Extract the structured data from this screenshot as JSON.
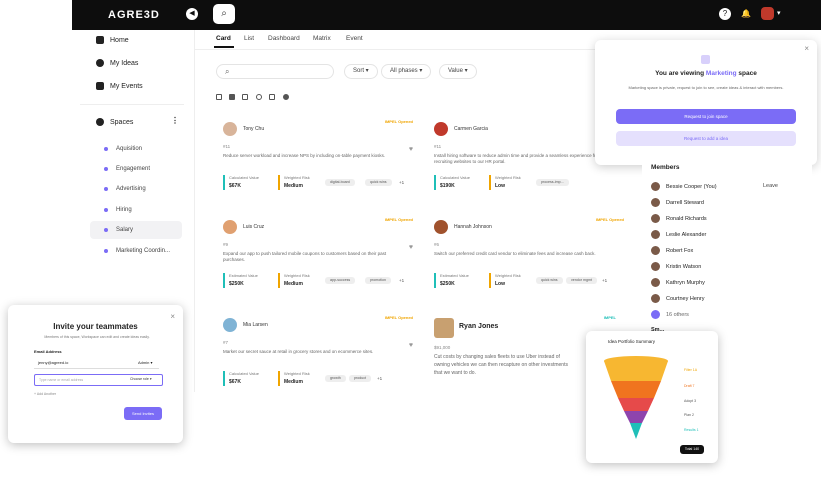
{
  "app": {
    "logo": "AGRE3D"
  },
  "colors": {
    "accent": "#7b6cf6",
    "teal": "#1fbfb8",
    "orange": "#f0a500"
  },
  "topbar": {
    "help_icon": "?",
    "notif_icon": "🔔"
  },
  "sidebar": {
    "items": [
      {
        "label": "Home",
        "icon": "home-icon"
      },
      {
        "label": "My Ideas",
        "icon": "lightbulb-icon"
      },
      {
        "label": "My Events",
        "icon": "calendar-icon"
      }
    ],
    "spaces_label": "Spaces",
    "spaces": [
      "Aquisition",
      "Engagement",
      "Advertising",
      "Hiring",
      "Salary",
      "Marketing Coordin..."
    ]
  },
  "tabs": [
    "Card",
    "List",
    "Dashboard",
    "Matrix",
    "Event"
  ],
  "filters": {
    "sort": "Sort",
    "phases": "All phases",
    "value": "Value"
  },
  "cards": [
    {
      "name": "Tony Chu",
      "tag": "IMPEL Opened",
      "id": "#11",
      "desc": "Reduce server workload and increase NPS by including on-table payment kiosks.",
      "m1l": "Calculated Value",
      "m1v": "$67K",
      "m2l": "Weighted Risk",
      "m2v": "Medium",
      "chips": [
        "digital-board",
        "quick wins"
      ],
      "more": "+1"
    },
    {
      "name": "Carmen Garcia",
      "tag": "IMPEL Opened",
      "id": "#11",
      "desc": "Install hiring software to reduce admin time and provide a seamless experience from recruiting websites to our HR portal.",
      "m1l": "Calculated Value",
      "m1v": "$190K",
      "m2l": "Weighted Risk",
      "m2v": "Low",
      "chips": [
        "process-imp..."
      ],
      "more": ""
    },
    {
      "name": "Luis Cruz",
      "tag": "IMPEL Opened",
      "id": "#9",
      "desc": "Expand our app to push tailored mobile coupons to customers based on their past purchases.",
      "m1l": "Estimated Value",
      "m1v": "$250K",
      "m2l": "Weighted Risk",
      "m2v": "Medium",
      "chips": [
        "app-success",
        "promotion"
      ],
      "more": "+1"
    },
    {
      "name": "Hannah Johnson",
      "tag": "IMPEL Opened",
      "id": "#6",
      "desc": "Switch our preferred credit card vendor to eliminate fees and increase cash back.",
      "m1l": "Estimated Value",
      "m1v": "$250K",
      "m2l": "Weighted Risk",
      "m2v": "Low",
      "chips": [
        "quick wins",
        "vendor mgmt"
      ],
      "more": "+1"
    },
    {
      "name": "Mia Larsen",
      "tag": "IMPEL Opened",
      "id": "#7",
      "desc": "Market our secret sauce at retail in grocery stores and on ecommerce sites.",
      "m1l": "Calculated Value",
      "m1v": "$67K",
      "m2l": "Weighted Risk",
      "m2v": "Medium",
      "chips": [
        "growth",
        "product"
      ],
      "more": "+1"
    },
    {
      "name": "Ryan Jones",
      "tag": "IMPEL",
      "id": "$91,000",
      "desc": "Cut costs by changing sales fleets to use Uber instead of owning vehicles we can then recapture on other investments that we want to do.",
      "m1l": "",
      "m1v": "",
      "m2l": "",
      "m2v": "",
      "chips": [],
      "more": ""
    }
  ],
  "popup": {
    "prefix": "You are viewing ",
    "space": "Marketing",
    "suffix": " space",
    "desc": "Marketing space is private, request to join to see, create ideas & interact with members.",
    "btn1": "Request to join space",
    "btn2": "Request to add a idea",
    "close": "×"
  },
  "members": {
    "title": "Members",
    "list": [
      "Bessie Cooper (You)",
      "Darrell Steward",
      "Ronald Richards",
      "Leslie Alexander",
      "Robert Fox",
      "Kristin Watson",
      "Kathryn Murphy",
      "Courtney Henry"
    ],
    "leave": "Leave",
    "others": "16 others",
    "footer": "Sm..."
  },
  "invite": {
    "title": "Invite your teammates",
    "subtitle": "Members of this space, Workspace can edit and create ideas easily.",
    "email_label": "Email Address",
    "email_value": "jenny@agreed.io",
    "role": "Admin",
    "input_placeholder": "Type name or email address",
    "choose_role": "Choose role",
    "add_another": "+ Add Another",
    "send": "Send Invites",
    "close": "×"
  },
  "funnel": {
    "title": "Idea Portfolio Summary",
    "labels": [
      "Filter 1A",
      "Draft 7",
      "Adopt 3",
      "Plan 2",
      "Results 1"
    ],
    "colors": [
      "#f7b731",
      "#f0741f",
      "#e64a4a",
      "#8e44ad",
      "#1fbfb8"
    ],
    "total": "Total 140"
  }
}
